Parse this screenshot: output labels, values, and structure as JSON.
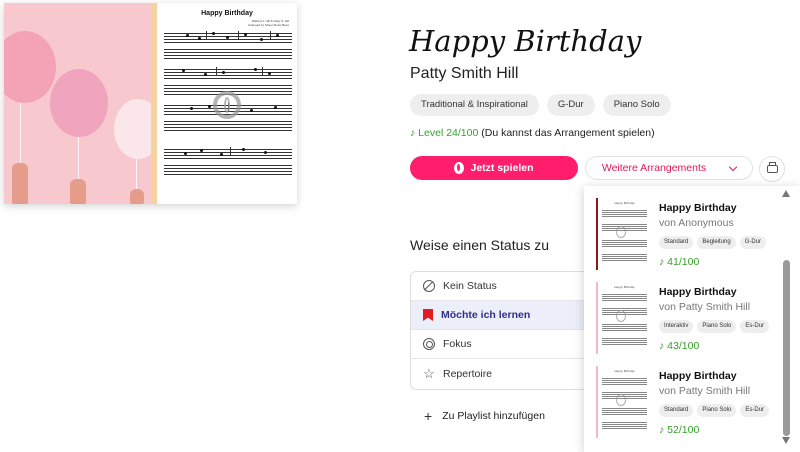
{
  "cover": {
    "score_title": "Happy Birthday",
    "credit_line1": "Mildred J. Hill & Patty S. Hill",
    "credit_line2": "Arranged by Sheet Music Boss"
  },
  "song": {
    "title": "Happy Birthday",
    "composer": "Patty Smith Hill",
    "tags": [
      "Traditional & Inspirational",
      "G-Dur",
      "Piano Solo"
    ],
    "level_label": "Level 24/100",
    "level_note": "(Du kannst das Arrangement spielen)"
  },
  "actions": {
    "play_label": "Jetzt spielen",
    "more_label": "Weitere Arrangements"
  },
  "status": {
    "heading": "Weise einen Status zu",
    "options": [
      {
        "label": "Kein Status",
        "icon": "no-status-icon",
        "active": false
      },
      {
        "label": "Möchte ich lernen",
        "icon": "bookmark-icon",
        "active": true
      },
      {
        "label": "Fokus",
        "icon": "focus-icon",
        "active": false
      },
      {
        "label": "Repertoire",
        "icon": "star-icon",
        "active": false
      }
    ],
    "playlist_label": "Zu Playlist hinzufügen"
  },
  "arrangements": [
    {
      "title": "Happy Birthday",
      "by": "von Anonymous",
      "tags": [
        "Standard",
        "Begleitung",
        "G-Dur"
      ],
      "level": "41/100",
      "accent": "#8b1a1a"
    },
    {
      "title": "Happy Birthday",
      "by": "von Patty Smith Hill",
      "tags": [
        "Interaktiv",
        "Piano Solo",
        "Es-Dur"
      ],
      "level": "43/100",
      "accent": "#f5b7c2"
    },
    {
      "title": "Happy Birthday",
      "by": "von Patty Smith Hill",
      "tags": [
        "Standard",
        "Piano Solo",
        "Es-Dur"
      ],
      "level": "52/100",
      "accent": "#f5b7c2"
    }
  ],
  "colors": {
    "accent_pink": "#ff1d6c",
    "level_green": "#36a12c",
    "active_status_bg": "#eceef9"
  }
}
